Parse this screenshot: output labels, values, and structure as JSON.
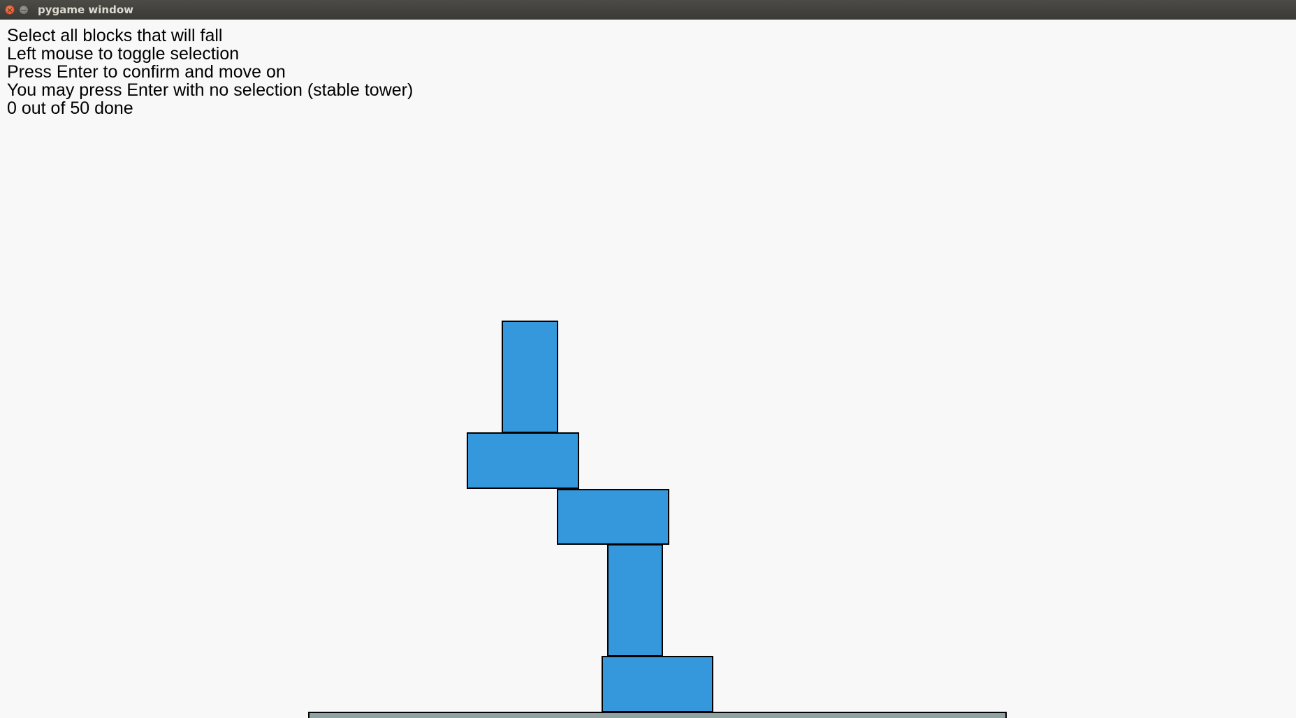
{
  "window": {
    "title": "pygame window",
    "close_icon": "close-icon",
    "minimize_icon": "minimize-icon"
  },
  "instructions": [
    "Select all blocks that will fall",
    "Left mouse to toggle selection",
    "Press Enter to confirm and move on",
    "You may press Enter with no selection (stable tower)",
    "0 out of 50 done"
  ],
  "progress": {
    "done": 0,
    "total": 50
  },
  "tower": {
    "block_color": "#3598dc",
    "outline_color": "#000000",
    "ground_color": "#8ea2a2",
    "block_count": 5
  },
  "colors": {
    "background": "#f8f8f8",
    "text": "#000000",
    "titlebar": "#3f3e3a"
  }
}
